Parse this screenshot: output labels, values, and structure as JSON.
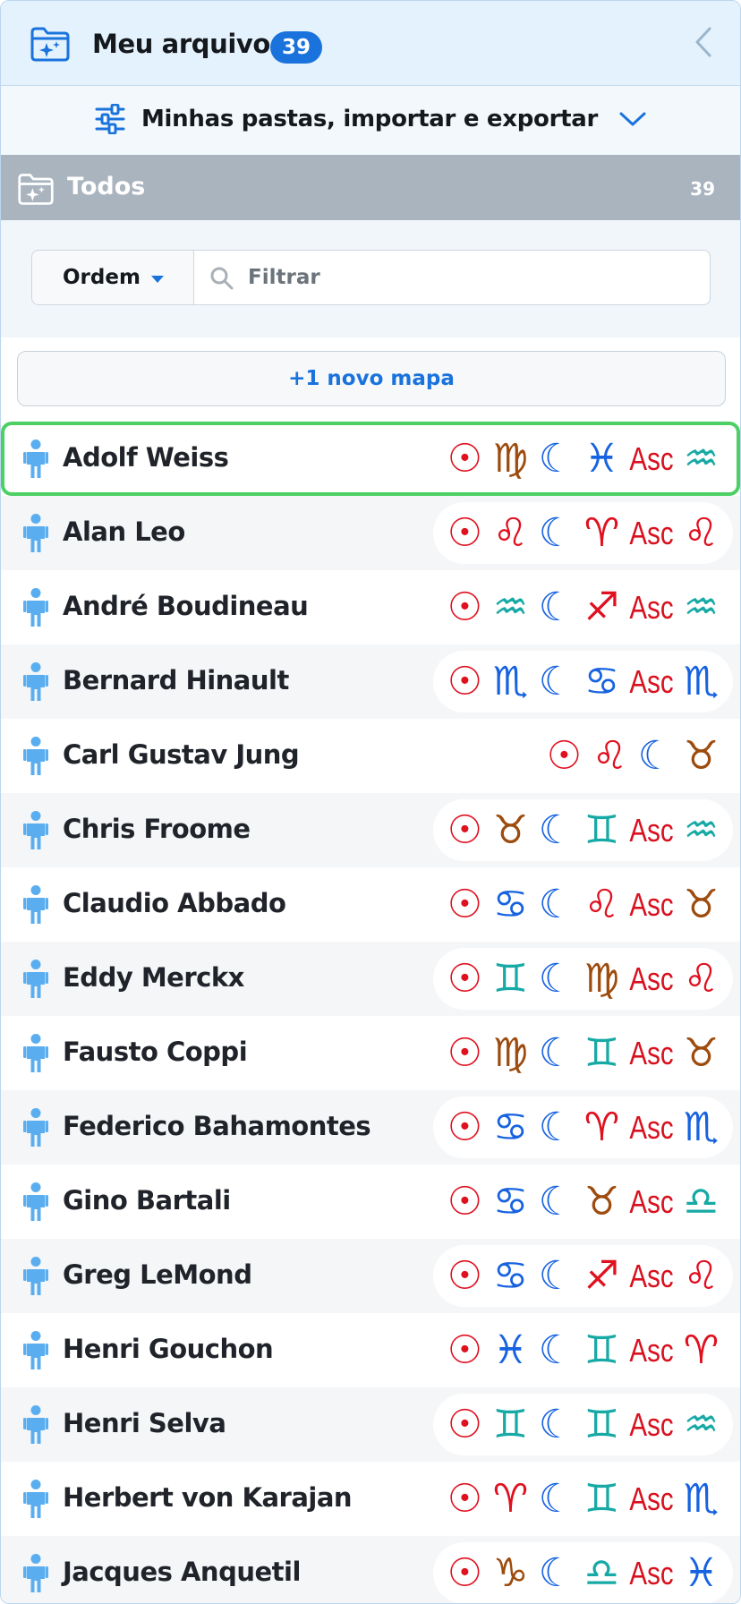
{
  "header": {
    "title": "Meu arquivo",
    "count": "39"
  },
  "folders": {
    "label": "Minhas pastas, importar e exportar"
  },
  "all_folder": {
    "label": "Todos",
    "count": "39"
  },
  "filter": {
    "sort_label": "Ordem",
    "search_placeholder": "Filtrar",
    "search_value": ""
  },
  "new_map": {
    "label": "+1 novo mapa"
  },
  "symbols": {
    "sun": "☉",
    "moon": "☾",
    "asc": "Asc"
  },
  "colors": {
    "accent": "#1a73dd",
    "selected_border": "#4cd064",
    "fire": "#e0101f",
    "earth": "#9d4c0e",
    "air": "#17a9a5",
    "water": "#1662e0"
  },
  "rows": [
    {
      "name": "Adolf Weiss",
      "sun": "♍",
      "sun_el": "earth",
      "moon": "♓",
      "moon_el": "water",
      "asc": "♒",
      "asc_el": "air",
      "selected": true
    },
    {
      "name": "Alan Leo",
      "sun": "♌",
      "sun_el": "fire",
      "moon": "♈",
      "moon_el": "fire",
      "asc": "♌",
      "asc_el": "fire"
    },
    {
      "name": "André Boudineau",
      "sun": "♒",
      "sun_el": "air",
      "moon": "♐",
      "moon_el": "fire",
      "asc": "♒",
      "asc_el": "air"
    },
    {
      "name": "Bernard Hinault",
      "sun": "♏",
      "sun_el": "water",
      "moon": "♋",
      "moon_el": "water",
      "asc": "♏",
      "asc_el": "water"
    },
    {
      "name": "Carl Gustav Jung",
      "sun": "♌",
      "sun_el": "fire",
      "moon": "♉",
      "moon_el": "earth",
      "asc": "",
      "asc_el": ""
    },
    {
      "name": "Chris Froome",
      "sun": "♉",
      "sun_el": "earth",
      "moon": "♊",
      "moon_el": "air",
      "asc": "♒",
      "asc_el": "air"
    },
    {
      "name": "Claudio Abbado",
      "sun": "♋",
      "sun_el": "water",
      "moon": "♌",
      "moon_el": "fire",
      "asc": "♉",
      "asc_el": "earth"
    },
    {
      "name": "Eddy Merckx",
      "sun": "♊",
      "sun_el": "air",
      "moon": "♍",
      "moon_el": "earth",
      "asc": "♌",
      "asc_el": "fire"
    },
    {
      "name": "Fausto Coppi",
      "sun": "♍",
      "sun_el": "earth",
      "moon": "♊",
      "moon_el": "air",
      "asc": "♉",
      "asc_el": "earth"
    },
    {
      "name": "Federico Bahamontes",
      "sun": "♋",
      "sun_el": "water",
      "moon": "♈",
      "moon_el": "fire",
      "asc": "♏",
      "asc_el": "water"
    },
    {
      "name": "Gino Bartali",
      "sun": "♋",
      "sun_el": "water",
      "moon": "♉",
      "moon_el": "earth",
      "asc": "♎",
      "asc_el": "air"
    },
    {
      "name": "Greg LeMond",
      "sun": "♋",
      "sun_el": "water",
      "moon": "♐",
      "moon_el": "fire",
      "asc": "♌",
      "asc_el": "fire"
    },
    {
      "name": "Henri Gouchon",
      "sun": "♓",
      "sun_el": "water",
      "moon": "♊",
      "moon_el": "air",
      "asc": "♈",
      "asc_el": "fire"
    },
    {
      "name": "Henri Selva",
      "sun": "♊",
      "sun_el": "air",
      "moon": "♊",
      "moon_el": "air",
      "asc": "♒",
      "asc_el": "air"
    },
    {
      "name": "Herbert von Karajan",
      "sun": "♈",
      "sun_el": "fire",
      "moon": "♊",
      "moon_el": "air",
      "asc": "♏",
      "asc_el": "water"
    },
    {
      "name": "Jacques Anquetil",
      "sun": "♑",
      "sun_el": "earth",
      "moon": "♎",
      "moon_el": "air",
      "asc": "♓",
      "asc_el": "water"
    }
  ]
}
